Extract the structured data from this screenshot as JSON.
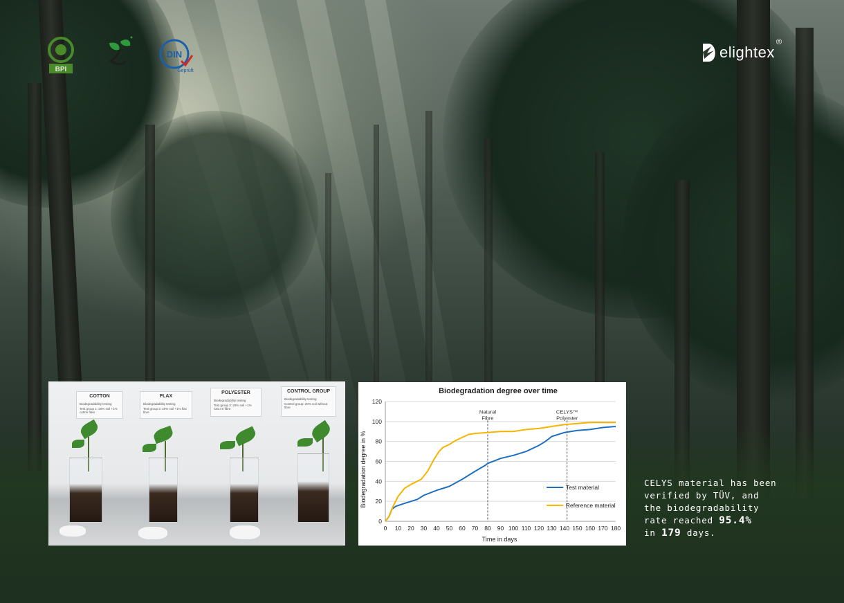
{
  "brand": {
    "name": "elightex",
    "registered": "®"
  },
  "badges": [
    {
      "name": "bpi-logo",
      "label": "BPI"
    },
    {
      "name": "seedling-logo",
      "label": "Seedling"
    },
    {
      "name": "din-geprueft-logo",
      "label": "DIN",
      "sublabel": "Geprüft"
    }
  ],
  "photo": {
    "notes": [
      {
        "title": "COTTON",
        "line1": "Biodegradability testing",
        "line2": "Test group 1: 20% soil +1% cotton fibre"
      },
      {
        "title": "FLAX",
        "line1": "Biodegradability testing",
        "line2": "Test group 2: 20% soil +1% flax fibre"
      },
      {
        "title": "POLYESTER",
        "line1": "Biodegradability testing",
        "line2": "Test group 3: 20% soil +1% CELYS fibre"
      },
      {
        "title": "CONTROL GROUP",
        "line1": "Biodegradability testing",
        "line2": "Control group: 20% soil without fibre"
      }
    ]
  },
  "chart_data": {
    "type": "line",
    "title": "Biodegradation degree over time",
    "xlabel": "Time in days",
    "ylabel": "Biodegradation degree in %",
    "xlim": [
      0,
      180
    ],
    "ylim": [
      0,
      120
    ],
    "x_ticks": [
      "0",
      "10",
      "20",
      "30",
      "40",
      "50",
      "60",
      "70",
      "80",
      "90",
      "100",
      "110",
      "120",
      "130",
      "140",
      "150",
      "160",
      "170",
      "180"
    ],
    "y_ticks": [
      "0",
      "20",
      "40",
      "60",
      "80",
      "100",
      "120"
    ],
    "grid": true,
    "legend_position": "bottom-right",
    "annotations": [
      {
        "label": "Natural Fibre",
        "x": 80
      },
      {
        "label": "CELYS™ Polyester",
        "x": 142
      }
    ],
    "series": [
      {
        "name": "Test material",
        "color": "#1f6fbf",
        "points": [
          [
            0,
            0
          ],
          [
            3,
            5
          ],
          [
            5,
            12
          ],
          [
            8,
            15
          ],
          [
            15,
            18
          ],
          [
            25,
            22
          ],
          [
            30,
            26
          ],
          [
            40,
            31
          ],
          [
            50,
            35
          ],
          [
            60,
            42
          ],
          [
            70,
            50
          ],
          [
            78,
            56
          ],
          [
            80,
            58
          ],
          [
            90,
            63
          ],
          [
            100,
            66
          ],
          [
            110,
            70
          ],
          [
            120,
            76
          ],
          [
            125,
            80
          ],
          [
            130,
            85
          ],
          [
            140,
            89
          ],
          [
            150,
            91
          ],
          [
            160,
            92
          ],
          [
            170,
            94
          ],
          [
            180,
            95
          ]
        ]
      },
      {
        "name": "Reference material",
        "color": "#f5b400",
        "points": [
          [
            0,
            0
          ],
          [
            3,
            5
          ],
          [
            6,
            15
          ],
          [
            10,
            25
          ],
          [
            15,
            33
          ],
          [
            20,
            37
          ],
          [
            28,
            42
          ],
          [
            33,
            50
          ],
          [
            38,
            62
          ],
          [
            42,
            70
          ],
          [
            45,
            74
          ],
          [
            50,
            77
          ],
          [
            55,
            81
          ],
          [
            60,
            84
          ],
          [
            65,
            87
          ],
          [
            70,
            88
          ],
          [
            80,
            89
          ],
          [
            90,
            90
          ],
          [
            100,
            90
          ],
          [
            110,
            92
          ],
          [
            120,
            93
          ],
          [
            130,
            95
          ],
          [
            140,
            97
          ],
          [
            150,
            98
          ],
          [
            160,
            99
          ],
          [
            170,
            99
          ],
          [
            180,
            99
          ]
        ]
      }
    ]
  },
  "caption": {
    "line1": "CELYS material has been",
    "line2": "verified by TÜV, and",
    "line3": "the biodegradability",
    "line4_prefix": "rate reached ",
    "rate": "95.4%",
    "line5_prefix": "in ",
    "days": "179",
    "line5_suffix": " days."
  }
}
